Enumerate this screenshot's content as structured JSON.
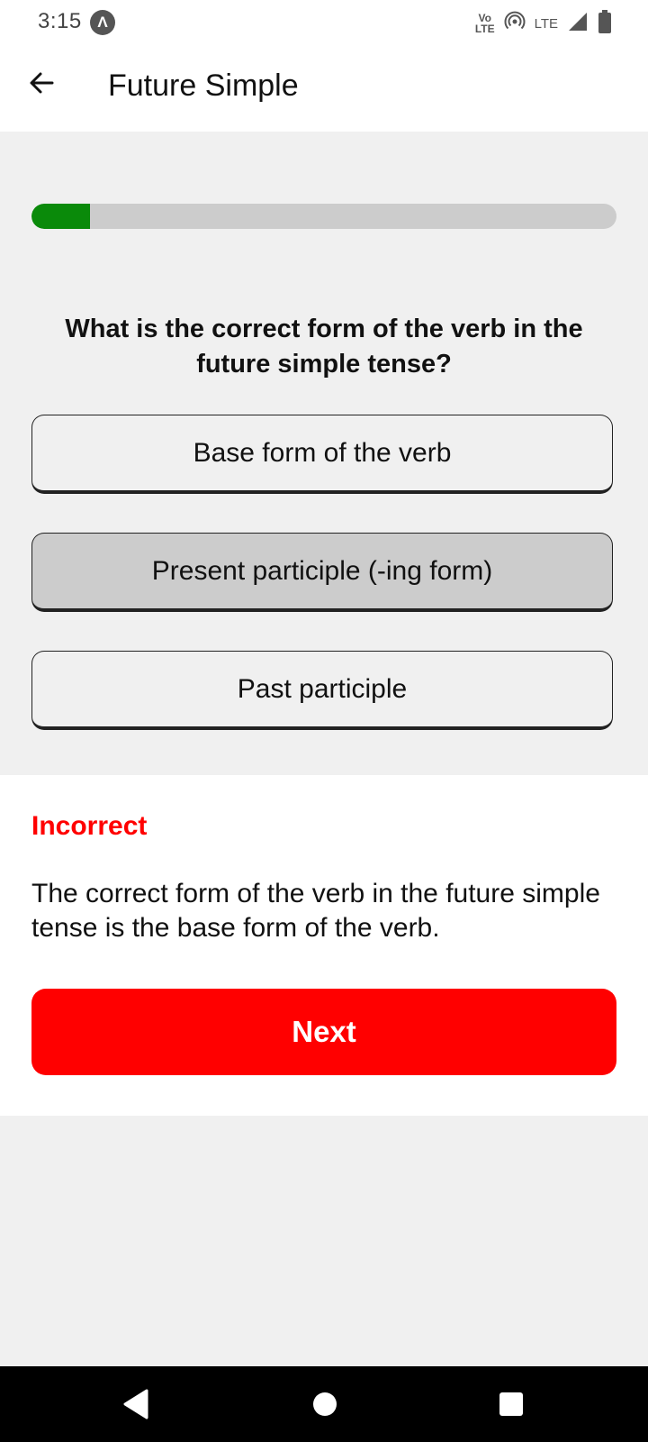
{
  "status_bar": {
    "time": "3:15",
    "app_icon_glyph": "Λ",
    "volte_top": "Vo",
    "volte_bottom": "LTE",
    "network": "LTE",
    "icons": [
      "volte-icon",
      "hotspot-icon",
      "signal-icon",
      "battery-icon"
    ]
  },
  "app_bar": {
    "title": "Future Simple",
    "back_icon": "arrow-left-icon"
  },
  "quiz": {
    "progress_fraction": 0.1,
    "progress_color": "#0a8a0a",
    "question": "What is the correct form of the verb in the future simple tense?",
    "options": [
      {
        "label": "Base form of the verb",
        "selected": false
      },
      {
        "label": "Present participle (-ing form)",
        "selected": true
      },
      {
        "label": "Past participle",
        "selected": false
      }
    ]
  },
  "feedback": {
    "title": "Incorrect",
    "title_color": "#ff0000",
    "explanation": "The correct form of the verb in the future simple tense is the base form of the verb.",
    "next_label": "Next",
    "next_color": "#ff0000"
  },
  "nav_bar": {
    "icons": [
      "back-triangle-icon",
      "home-circle-icon",
      "recents-square-icon"
    ]
  }
}
